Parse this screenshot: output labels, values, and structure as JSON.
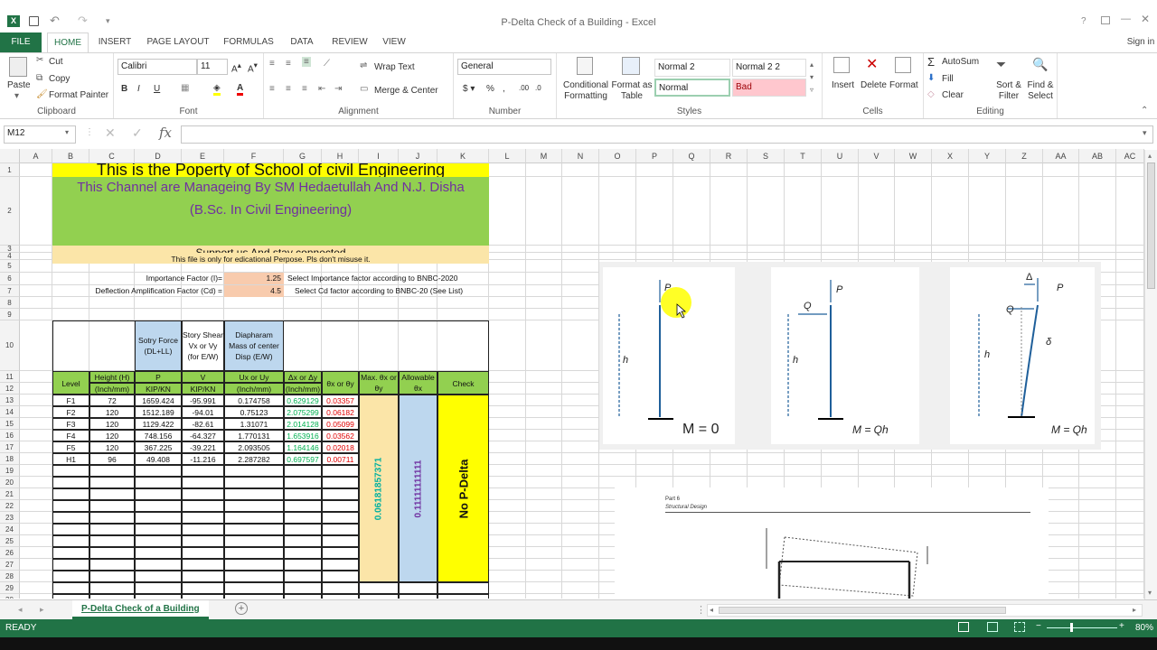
{
  "window": {
    "title": "P-Delta Check of a Building - Excel",
    "help": "?",
    "sign_in": "Sign in"
  },
  "tabs": [
    "FILE",
    "HOME",
    "INSERT",
    "PAGE LAYOUT",
    "FORMULAS",
    "DATA",
    "REVIEW",
    "VIEW"
  ],
  "clipboard": {
    "paste": "Paste",
    "cut": "Cut",
    "copy": "Copy",
    "format_painter": "Format Painter",
    "label": "Clipboard"
  },
  "font": {
    "name": "Calibri",
    "size": "11",
    "label": "Font"
  },
  "alignment": {
    "wrap": "Wrap Text",
    "merge": "Merge & Center",
    "label": "Alignment"
  },
  "number": {
    "format": "General",
    "label": "Number"
  },
  "styles": {
    "cond": "Conditional Formatting",
    "table": "Format as Table",
    "normal2": "Normal 2",
    "normal22": "Normal 2 2",
    "normal": "Normal",
    "bad": "Bad",
    "label": "Styles"
  },
  "cells": {
    "insert": "Insert",
    "delete": "Delete",
    "format": "Format",
    "label": "Cells"
  },
  "editing": {
    "autosum": "AutoSum",
    "fill": "Fill",
    "clear": "Clear",
    "sort": "Sort & Filter",
    "find": "Find & Select",
    "label": "Editing"
  },
  "formula_bar": {
    "name_box": "M12",
    "formula": ""
  },
  "columns": [
    "A",
    "B",
    "C",
    "D",
    "E",
    "F",
    "G",
    "H",
    "I",
    "J",
    "K",
    "L",
    "M",
    "N",
    "O",
    "P",
    "Q",
    "R",
    "S",
    "T",
    "U",
    "V",
    "W",
    "X",
    "Y",
    "Z",
    "AA",
    "AB",
    "AC"
  ],
  "rows": [
    "1",
    "2",
    "3",
    "4",
    "5",
    "6",
    "7",
    "8",
    "9",
    "10",
    "11",
    "12",
    "13",
    "14",
    "15",
    "16",
    "17",
    "18",
    "19",
    "20",
    "21",
    "22",
    "23",
    "24",
    "25",
    "26",
    "27",
    "28",
    "29",
    "30"
  ],
  "banner": {
    "line1": "This is the Poperty of School of civil Engineering",
    "line2a": "This Channel are Manageing By SM Hedaetullah And N.J. Disha",
    "line2b": "(B.Sc. In Civil Engineering)",
    "line3": "Support us And stay connected",
    "line4": "This file is only for edicational Perpose. Pls don't misuse it."
  },
  "inputs": {
    "imp_label": "Importance Factor (I)=",
    "imp_val": "1.25",
    "imp_note": "Select Importance factor according to BNBC-2020",
    "cd_label": "Deflection Amplification Factor (Cd) =",
    "cd_val": "4.5",
    "cd_note": "Select Cd factor according to BNBC-20 (See List)"
  },
  "table": {
    "h10": {
      "d": "Sotry Force (DL+LL)",
      "e": "Story Shear Vx or Vy (for E/W)",
      "f": "Diapharam Mass of center Disp (E/W)"
    },
    "h11": {
      "b": "Level",
      "c": "Height (H)",
      "d": "P",
      "e": "V",
      "f": "Ux or Uy",
      "g": "Δx or Δy",
      "h": "θx or θy",
      "i": "Max. θx or θy",
      "j": "Allowable θx",
      "k": "Check"
    },
    "h12": {
      "c": "(Inch/mm)",
      "d": "KIP/KN",
      "e": "KIP/KN",
      "f": "(Inch/mm)",
      "g": "(Inch/mm)"
    },
    "rows": [
      [
        "F1",
        "72",
        "1659.424",
        "-95.991",
        "0.174758",
        "0.629129",
        "0.03357"
      ],
      [
        "F2",
        "120",
        "1512.189",
        "-94.01",
        "0.75123",
        "2.075299",
        "0.06182"
      ],
      [
        "F3",
        "120",
        "1129.422",
        "-82.61",
        "1.31071",
        "2.014128",
        "0.05099"
      ],
      [
        "F4",
        "120",
        "748.156",
        "-64.327",
        "1.770131",
        "1.653916",
        "0.03562"
      ],
      [
        "F5",
        "120",
        "367.225",
        "-39.221",
        "2.093505",
        "1.164146",
        "0.02018"
      ],
      [
        "H1",
        "96",
        "49.408",
        "-11.216",
        "2.287282",
        "0.697597",
        "0.00711"
      ]
    ],
    "max_theta": "0.06181857371",
    "allow_theta": "0.11111111111",
    "check": "No P-Delta"
  },
  "figure": {
    "p": "P",
    "q": "Q",
    "h": "h",
    "delta": "Δ",
    "d": "δ",
    "m0": "M = 0",
    "mqh": "M = Qh",
    "part": "Part 6",
    "struct": "Structural Design"
  },
  "sheet_tab": "P-Delta Check of a Building",
  "status": {
    "ready": "READY",
    "zoom": "80%"
  },
  "colors": {
    "excel_green": "#217346",
    "yellow": "#ffff00",
    "green": "#92d050",
    "tan": "#fbe5a8",
    "orange": "#f8cbad",
    "blue": "#bdd7ee",
    "teal": "#00b0a0"
  }
}
